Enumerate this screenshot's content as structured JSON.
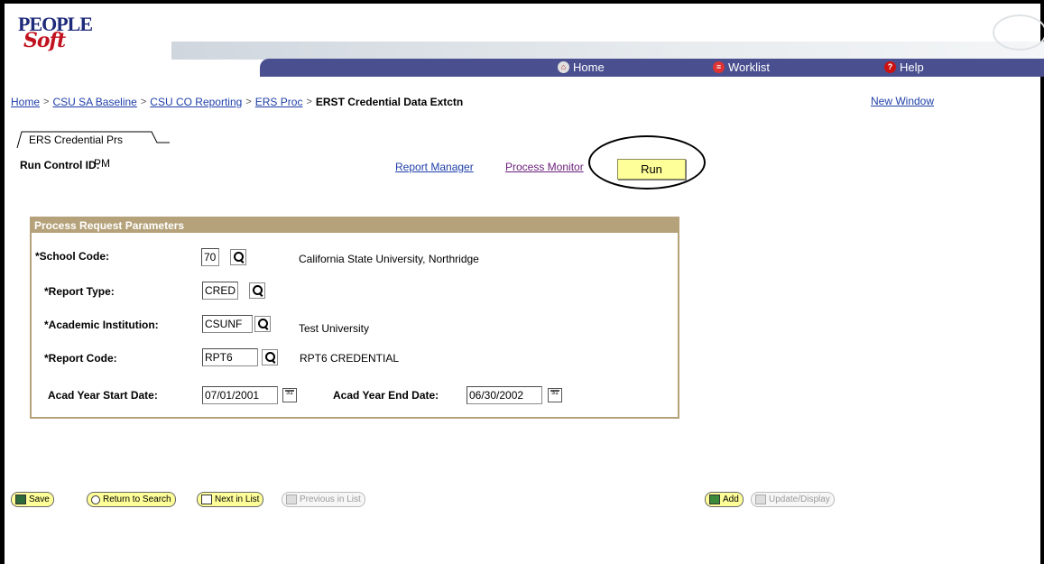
{
  "header": {
    "logo_top": "PEOPLE",
    "logo_bottom": "Soft",
    "nav": [
      {
        "label": "Home",
        "icon": "home-icon"
      },
      {
        "label": "Worklist",
        "icon": "worklist-icon"
      },
      {
        "label": "Help",
        "icon": "help-icon"
      }
    ]
  },
  "breadcrumb": {
    "links": [
      "Home",
      "CSU SA Baseline",
      "CSU CO Reporting",
      "ERS Proc"
    ],
    "separator": ">",
    "current": "ERST Credential Data Extctn",
    "new_window": "New Window"
  },
  "tab": {
    "label": "ERS Credential Prs"
  },
  "run_control": {
    "label": "Run Control ID:",
    "value": "PM",
    "report_manager": "Report Manager",
    "process_monitor": "Process Monitor",
    "run_button": "Run"
  },
  "params": {
    "title": "Process Request Parameters",
    "school_code": {
      "label": "*School Code:",
      "value": "70",
      "desc": "California State University, Northridge"
    },
    "report_type": {
      "label": "*Report Type:",
      "value": "CRED"
    },
    "academic_institution": {
      "label": "*Academic Institution:",
      "value": "CSUNF",
      "desc": "Test University"
    },
    "report_code": {
      "label": "*Report Code:",
      "value": "RPT6",
      "desc": "RPT6 CREDENTIAL"
    },
    "start_date": {
      "label": "Acad Year Start Date:",
      "value": "07/01/2001"
    },
    "end_date": {
      "label": "Acad Year End Date:",
      "value": "06/30/2002"
    },
    "calendar_icon_text": "31"
  },
  "toolbar": {
    "save": "Save",
    "return_to_search": "Return to Search",
    "next_in_list": "Next in List",
    "previous_in_list": "Previous in List",
    "add": "Add",
    "update_display": "Update/Display"
  },
  "colors": {
    "nav_bar": "#4a4f8f",
    "link": "#1f3fa8",
    "group_border": "#b5a27a",
    "button_yellow": "#ffff99"
  }
}
